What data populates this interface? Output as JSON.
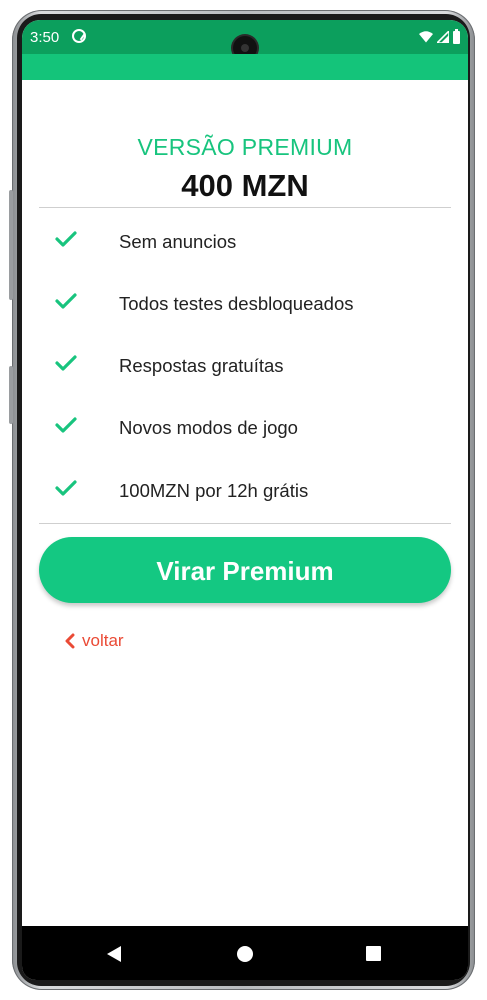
{
  "status_bar": {
    "time": "3:50",
    "icons": [
      "sync-icon",
      "wifi-icon",
      "signal-icon",
      "battery-icon"
    ]
  },
  "premium": {
    "title": "VERSÃO PREMIUM",
    "price": "400 MZN",
    "features": [
      "Sem anuncios",
      "Todos testes desbloqueados",
      "Respostas gratuítas",
      "Novos modos de jogo",
      "100MZN por 12h grátis"
    ],
    "button_label": "Virar Premium",
    "back_label": "voltar"
  },
  "colors": {
    "status_bar": "#0c9f5d",
    "app_bar": "#14c47a",
    "accent": "#18c47e",
    "button": "#14c882",
    "back_link": "#ea4a35"
  },
  "nav_bar": {
    "icons": [
      "back-triangle-icon",
      "home-circle-icon",
      "recents-square-icon"
    ]
  }
}
